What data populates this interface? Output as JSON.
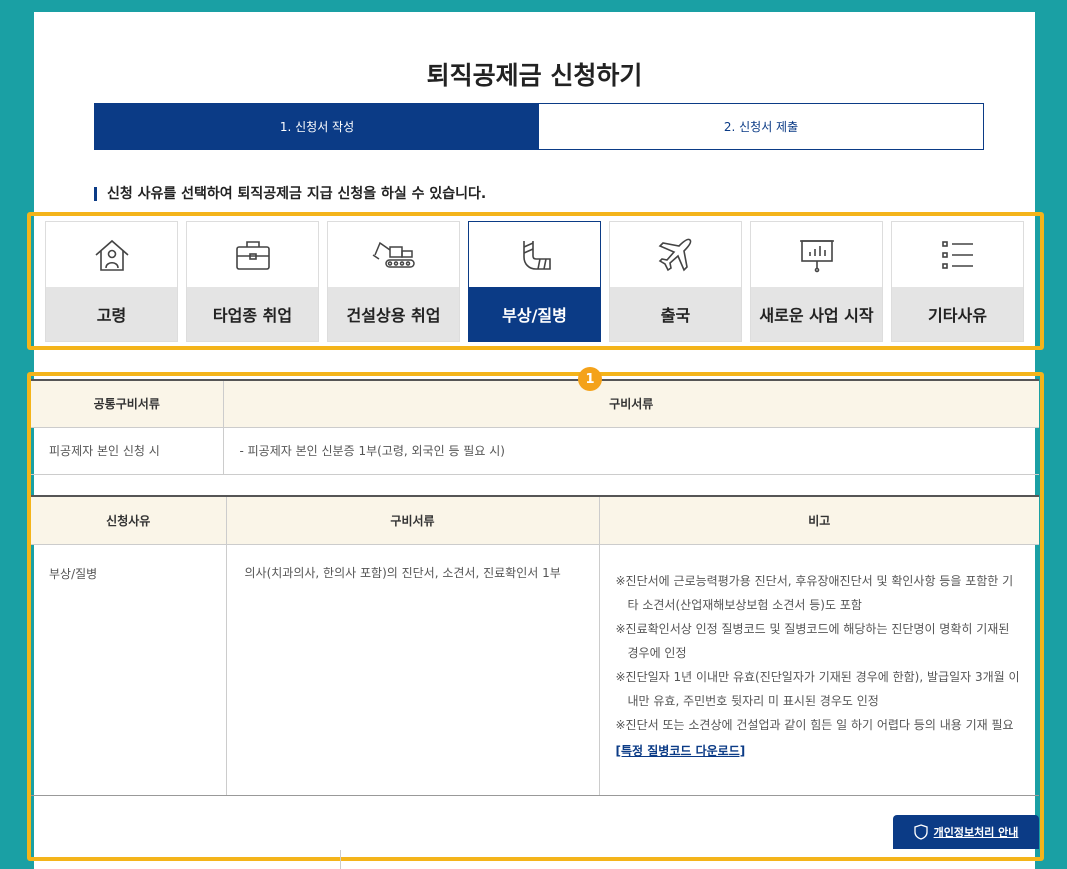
{
  "title": "퇴직공제금 신청하기",
  "steps": [
    {
      "label": "1. 신청서 작성",
      "active": true
    },
    {
      "label": "2. 신청서 제출",
      "active": false
    }
  ],
  "intro": "신청 사유를 선택하여 퇴직공제금 지급 신청을 하실 수 있습니다.",
  "badge": "1",
  "reasons": [
    {
      "label": "고령",
      "icon": "elderly-house-icon"
    },
    {
      "label": "타업종 취업",
      "icon": "briefcase-icon"
    },
    {
      "label": "건설상용 취업",
      "icon": "excavator-icon"
    },
    {
      "label": "부상/질병",
      "icon": "cast-arm-icon",
      "active": true
    },
    {
      "label": "출국",
      "icon": "airplane-icon"
    },
    {
      "label": "새로운 사업 시작",
      "icon": "presentation-board-icon"
    },
    {
      "label": "기타사유",
      "icon": "list-icon"
    }
  ],
  "common_table": {
    "headers": [
      "공통구비서류",
      "구비서류"
    ],
    "row": [
      "피공제자 본인 신청 시",
      "- 피공제자 본인 신분증 1부(고령, 외국인 등 필요 시)"
    ]
  },
  "detail_table": {
    "headers": [
      "신청사유",
      "구비서류",
      "비고"
    ],
    "reason": "부상/질병",
    "documents": "의사(치과의사, 한의사 포함)의 진단서, 소견서, 진료확인서 1부",
    "notes": [
      "※진단서에 근로능력평가용 진단서, 후유장애진단서 및 확인사항 등을 포함한 기타 소견서(산업재해보상보험 소견서 등)도 포함",
      "※진료확인서상 인정 질병코드 및 질병코드에 해당하는 진단명이 명확히 기재된 경우에 인정",
      "※진단일자 1년 이내만 유효(진단일자가 기재된 경우에 한함), 발급일자 3개월 이내만 유효, 주민번호 뒷자리 미 표시된 경우도 인정",
      "※진단서 또는 소견상에 건설업과 같이 힘든 일 하기 어렵다 등의 내용 기재 필요"
    ],
    "download_link": "[특정 질병코드 다운로드]"
  },
  "privacy_button": "개인정보처리 안내",
  "colors": {
    "navy": "#0b3b86",
    "highlight": "#f4b41a",
    "background": "#1aa0a4"
  }
}
